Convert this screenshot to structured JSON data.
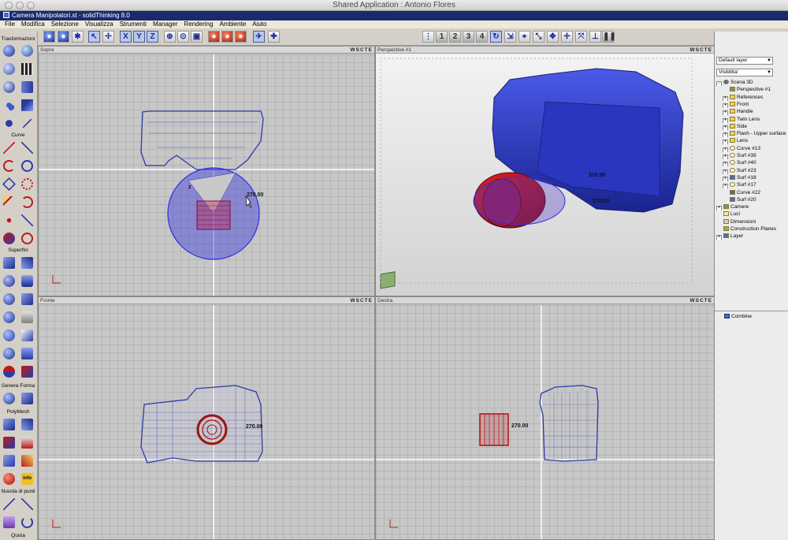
{
  "window": {
    "title": "Shared Application : Antonio Flores"
  },
  "app": {
    "title": "Camera Manipolatori.st - solidThinking 8.0"
  },
  "menu": [
    "File",
    "Modifica",
    "Selezione",
    "Visualizza",
    "Strumenti",
    "Manager",
    "Rendering",
    "Ambiente",
    "Aiuto"
  ],
  "toolbar": {
    "coord_x_label": "X",
    "coord_y_label": "Y",
    "coord_z_label": "Z",
    "view_numbers": [
      "1",
      "2",
      "3",
      "4"
    ]
  },
  "left_toolbar": {
    "sections": [
      "Trasformazioni",
      "Curve",
      "Superfici",
      "Genera Forma",
      "PolyMesh",
      "Nuvola di punti",
      "Quota"
    ],
    "info_label": "info"
  },
  "viewports": [
    {
      "id": "top",
      "name": "Sopra",
      "controls": "WSCTE",
      "dimension": "270.00",
      "axis_label": "z"
    },
    {
      "id": "perspective",
      "name": "Perspective #1",
      "controls": "WSCTE",
      "dimension_1": "310.00",
      "dimension_2": "270.00"
    },
    {
      "id": "front",
      "name": "Fronte",
      "controls": "WSCTE",
      "dimension": "270.00"
    },
    {
      "id": "right",
      "name": "Destra",
      "controls": "WSCTE",
      "dimension": "270.00"
    }
  ],
  "right_panel": {
    "layer_select": "Default layer",
    "visibility_select": "Visibilita'",
    "tree": [
      {
        "label": "Scena 3D",
        "level": 0,
        "expand": "-",
        "icon": "scene"
      },
      {
        "label": "Perspective #1",
        "level": 1,
        "expand": "",
        "icon": "camera"
      },
      {
        "label": "References",
        "level": 1,
        "expand": "+",
        "icon": "folder"
      },
      {
        "label": "Front",
        "level": 1,
        "expand": "+",
        "icon": "folder"
      },
      {
        "label": "Handle",
        "level": 1,
        "expand": "+",
        "icon": "folder"
      },
      {
        "label": "Twin Lens",
        "level": 1,
        "expand": "+",
        "icon": "folder"
      },
      {
        "label": "Side",
        "level": 1,
        "expand": "+",
        "icon": "folder"
      },
      {
        "label": "Flash - Upper surface",
        "level": 1,
        "expand": "+",
        "icon": "folder"
      },
      {
        "label": "Lens",
        "level": 1,
        "expand": "+",
        "icon": "folder"
      },
      {
        "label": "Curve #13",
        "level": 1,
        "expand": "+",
        "icon": "curve"
      },
      {
        "label": "Surf #39",
        "level": 1,
        "expand": "+",
        "icon": "curve"
      },
      {
        "label": "Surf #40",
        "level": 1,
        "expand": "+",
        "icon": "curve"
      },
      {
        "label": "Surf #23",
        "level": 1,
        "expand": "+",
        "icon": "curve"
      },
      {
        "label": "Surf #18",
        "level": 1,
        "expand": "+",
        "icon": "surf"
      },
      {
        "label": "Surf #17",
        "level": 1,
        "expand": "+",
        "icon": "curve"
      },
      {
        "label": "Curve #22",
        "level": 1,
        "expand": "",
        "icon": "surf"
      },
      {
        "label": "Surf #20",
        "level": 1,
        "expand": "",
        "icon": "surf"
      },
      {
        "label": "Camere",
        "level": 0,
        "expand": "+",
        "icon": "camera"
      },
      {
        "label": "Luci",
        "level": 0,
        "expand": "",
        "icon": "light"
      },
      {
        "label": "Dimensioni",
        "level": 0,
        "expand": "",
        "icon": "dim"
      },
      {
        "label": "Construction Planes",
        "level": 0,
        "expand": "",
        "icon": "plane"
      },
      {
        "label": "Layer",
        "level": 0,
        "expand": "+",
        "icon": "layer"
      }
    ],
    "history": [
      {
        "label": "Combine"
      }
    ]
  },
  "colors": {
    "accent": "#1a2a6e",
    "model_blue": "#2a38c8",
    "lens_red": "#c01818",
    "grid": "#c7c7c7"
  }
}
